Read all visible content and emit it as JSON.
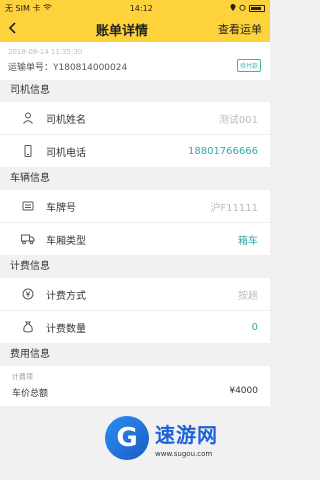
{
  "status_bar": {
    "carrier": "无 SIM 卡",
    "time": "14:12"
  },
  "nav": {
    "back_icon": "chevron-left",
    "title": "账单详情",
    "action": "查看运单"
  },
  "waybill": {
    "date": "2018-08-14 11:35:30",
    "number": "运输单号：Y180814000024",
    "status": "待付款"
  },
  "sections": {
    "driver": {
      "title": "司机信息",
      "name_label": "司机姓名",
      "name_value": "测试001",
      "phone_label": "司机电话",
      "phone_value": "18801766666"
    },
    "vehicle": {
      "title": "车辆信息",
      "plate_label": "车牌号",
      "plate_value": "沪F11111",
      "type_label": "车厢类型",
      "type_value": "箱车"
    },
    "billing": {
      "title": "计费信息",
      "method_label": "计费方式",
      "method_value": "按趟",
      "qty_label": "计费数量",
      "qty_value": "0"
    },
    "fee": {
      "title": "费用信息",
      "sub": "计费项",
      "total_label": "车价总额",
      "total_value": "¥4000"
    }
  },
  "watermark": {
    "brand": "速游网",
    "url": "www.sugou.com"
  },
  "colors": {
    "accent": "#fdd23a",
    "teal": "#2ea9a5"
  }
}
